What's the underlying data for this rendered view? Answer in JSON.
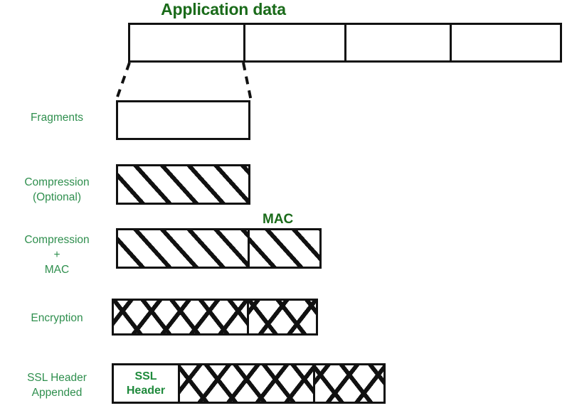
{
  "title": "Application data",
  "colors": {
    "title_green": "#1a6b1a",
    "label_green": "#2f8f4e",
    "header_green": "#1f8a3c",
    "outline": "#111111",
    "background": "#ffffff"
  },
  "stages": [
    {
      "id": "application-data",
      "label": "",
      "caption": "Application data",
      "cells": [
        {
          "fill": "plain",
          "text": ""
        },
        {
          "fill": "plain",
          "text": ""
        },
        {
          "fill": "plain",
          "text": ""
        },
        {
          "fill": "plain",
          "text": ""
        }
      ]
    },
    {
      "id": "fragments",
      "label": "Fragments",
      "cells": [
        {
          "fill": "plain",
          "text": ""
        }
      ]
    },
    {
      "id": "compression",
      "label_line1": "Compression",
      "label_line2": "(Optional)",
      "cells": [
        {
          "fill": "diagonal",
          "text": ""
        }
      ]
    },
    {
      "id": "compression-mac",
      "label_line1": "Compression",
      "label_line2": "+",
      "label_line3": "MAC",
      "caption": "MAC",
      "cells": [
        {
          "fill": "diagonal",
          "text": ""
        },
        {
          "fill": "diagonal",
          "text": ""
        }
      ]
    },
    {
      "id": "encryption",
      "label": "Encryption",
      "cells": [
        {
          "fill": "cross",
          "text": ""
        },
        {
          "fill": "cross",
          "text": ""
        }
      ]
    },
    {
      "id": "ssl-header",
      "label_line1": "SSL Header",
      "label_line2": "Appended",
      "header_text_line1": "SSL",
      "header_text_line2": "Header",
      "cells": [
        {
          "fill": "text",
          "text": "SSL Header"
        },
        {
          "fill": "cross",
          "text": ""
        },
        {
          "fill": "cross",
          "text": ""
        }
      ]
    }
  ]
}
